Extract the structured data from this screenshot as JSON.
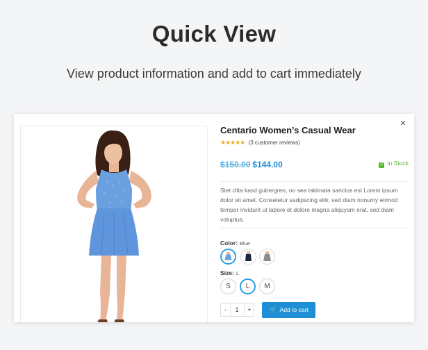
{
  "hero": {
    "title": "Quick View",
    "subtitle": "View product information and add to cart immediately"
  },
  "modal": {
    "close_glyph": "×",
    "product": {
      "title": "Centario Women’s Casual Wear",
      "stars": "★★★★★",
      "rating_value": 5,
      "reviews_text": "(3 customer reviews)",
      "old_price": "$150.00",
      "new_price": "$144.00",
      "stock_text": "In Stock",
      "description": "Stet clita kasd gubergren, no sea takimata sanctus est Lorem ipsum dolor sit amet. Consetetur sadipscing elitr, sed diam nonumy eirmod tempor invidunt ut labore et dolore magna aliquyam erat, sed diam voluptua.",
      "color_label": "Color:",
      "color_value": "Blue",
      "colors": [
        "blue",
        "navy",
        "grey"
      ],
      "size_label": "Size:",
      "size_value": "L",
      "sizes": [
        "S",
        "L",
        "M"
      ],
      "selected_size": "L",
      "quantity_minus": "-",
      "quantity": "1",
      "quantity_plus": "+",
      "add_to_cart": "Add to cart"
    }
  },
  "colors": {
    "accent": "#1e8fd6",
    "stock": "#58b52c",
    "star": "#f5a623",
    "dress_blue": "#6a9fe0",
    "dress_navy": "#1c2544",
    "dress_grey": "#8a8a8a"
  },
  "icons": {
    "close": "close-icon",
    "stock": "check-icon",
    "cart": "cart-icon"
  }
}
